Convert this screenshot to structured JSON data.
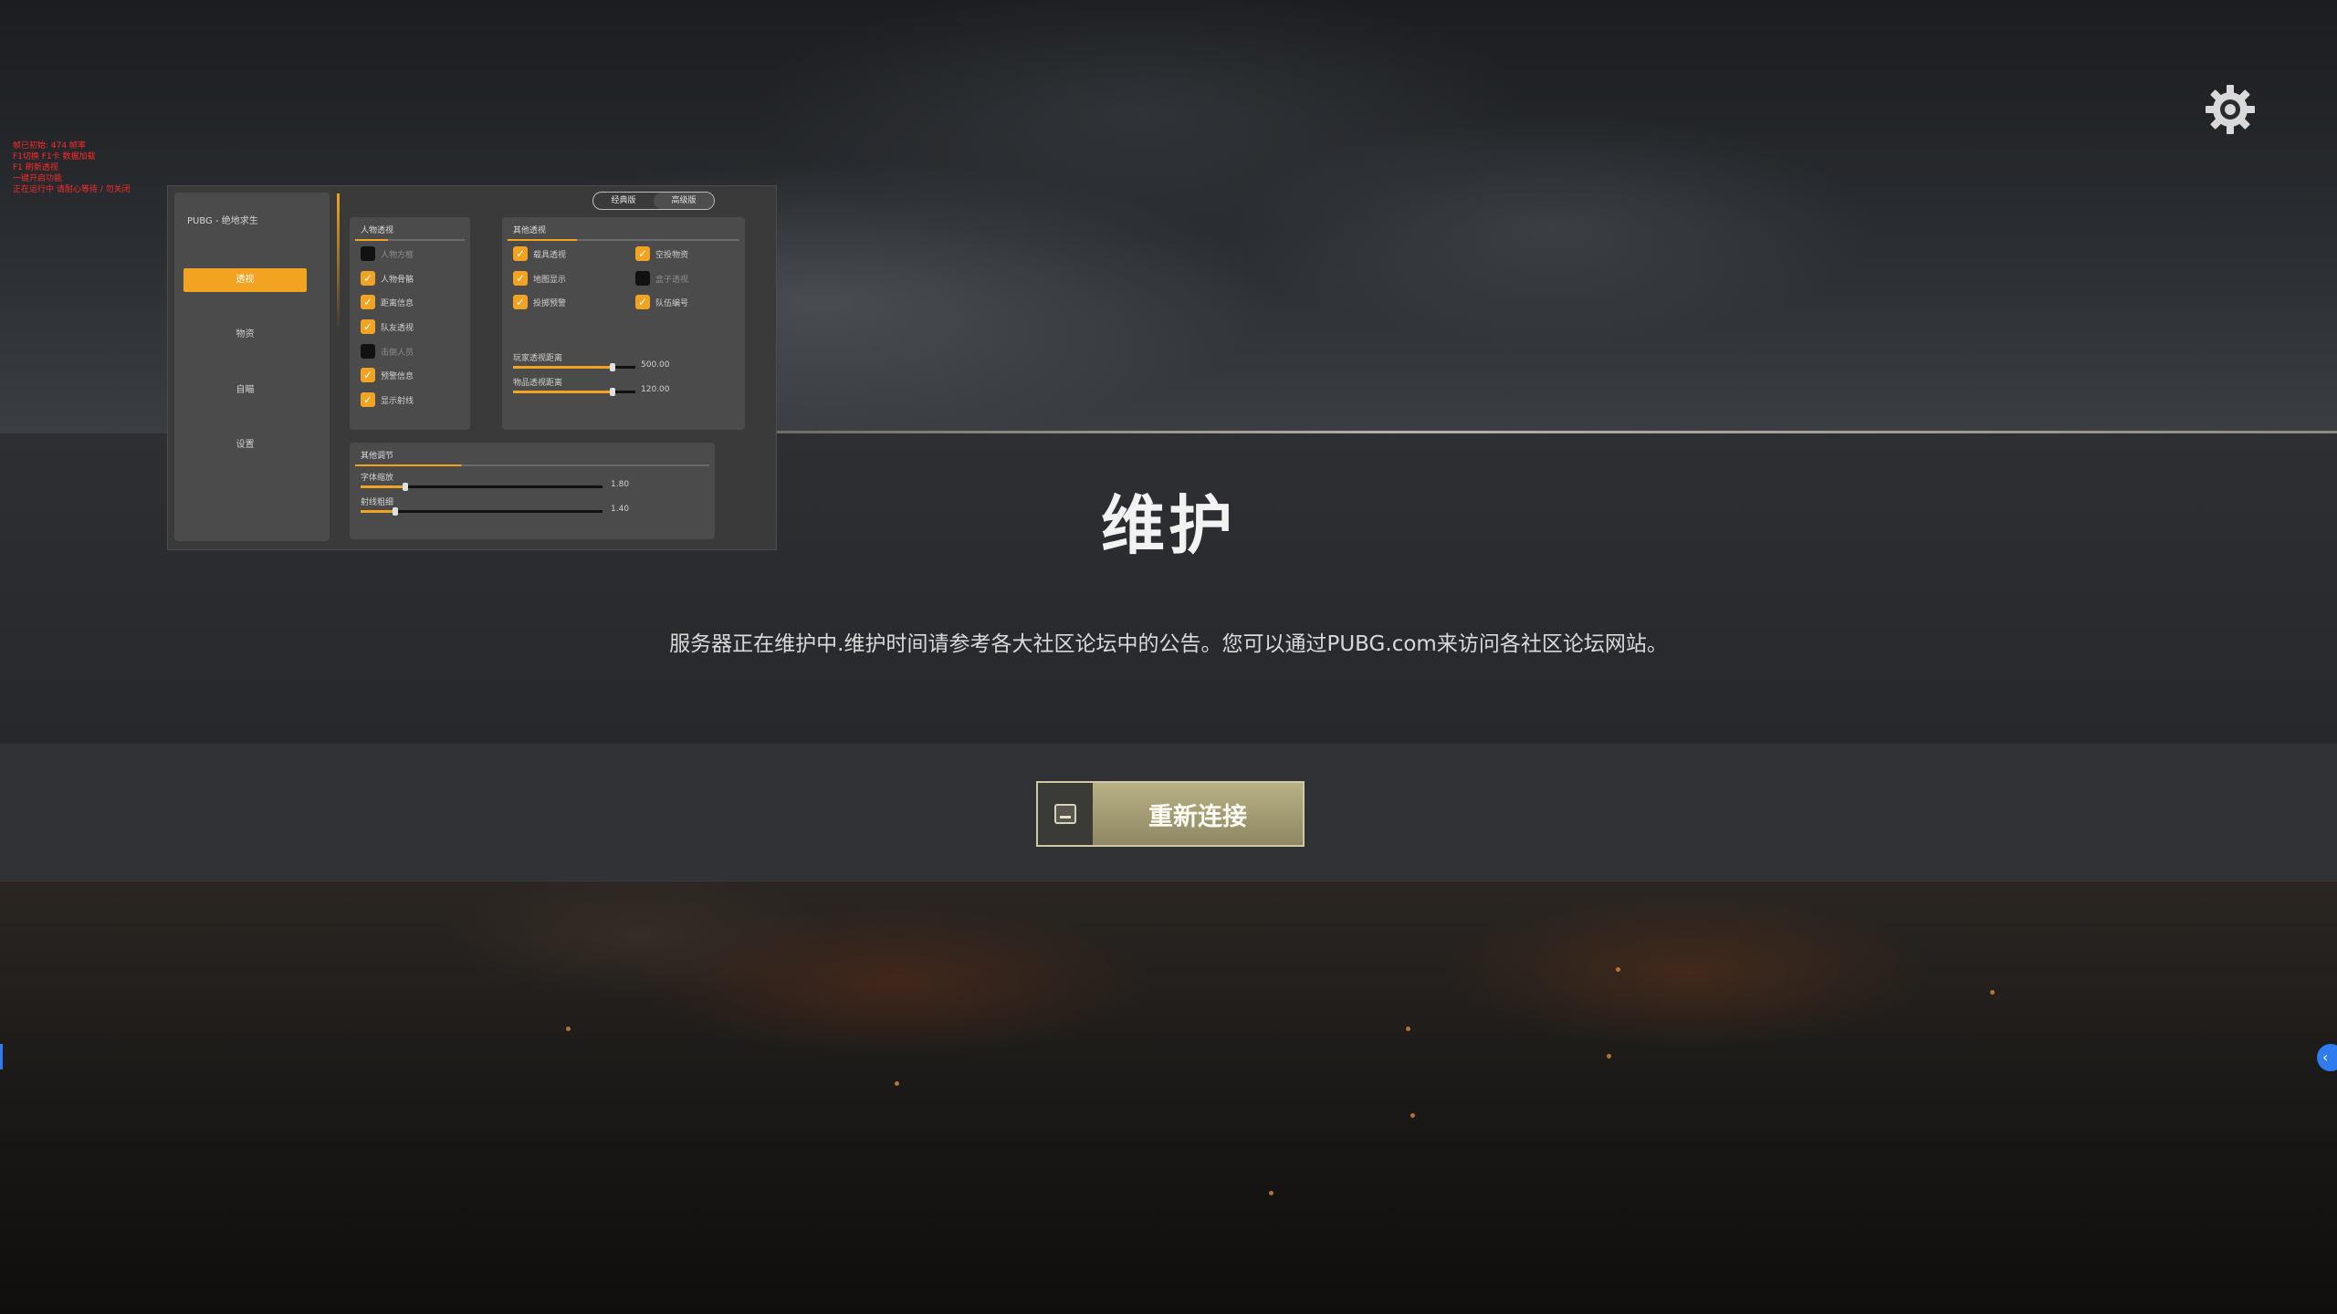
{
  "screen": {
    "title": "维护",
    "message": "服务器正在维护中.维护时间请参考各大社区论坛中的公告。您可以通过PUBG.com来访问各社区论坛网站。",
    "reconnect_label": "重新连接",
    "key_icon": "keyboard-key-icon",
    "settings_icon": "gear-icon"
  },
  "debug_overlay": {
    "lines": [
      "帧已初始: 474 帧率",
      "F1切换 F1卡 数据加载",
      "F1 刷新透视",
      "一键开启功能",
      "正在运行中 请耐心等待 / 勿关闭"
    ]
  },
  "cheat_menu": {
    "app_title": "PUBG - 绝地求生",
    "nav": [
      {
        "label": "透视",
        "active": true
      },
      {
        "label": "物资",
        "active": false
      },
      {
        "label": "自瞄",
        "active": false
      },
      {
        "label": "设置",
        "active": false
      }
    ],
    "mode_tabs": [
      {
        "label": "经典版",
        "active": false
      },
      {
        "label": "高级版",
        "active": true
      }
    ],
    "person_group": {
      "title": "人物透视",
      "items": [
        {
          "label": "人物方框",
          "checked": false
        },
        {
          "label": "人物骨骼",
          "checked": true
        },
        {
          "label": "距离信息",
          "checked": true
        },
        {
          "label": "队友透视",
          "checked": true
        },
        {
          "label": "击倒人员",
          "checked": false
        },
        {
          "label": "预警信息",
          "checked": true
        },
        {
          "label": "显示射线",
          "checked": true
        }
      ]
    },
    "other_group": {
      "title": "其他透视",
      "left_items": [
        {
          "label": "载具透视",
          "checked": true
        },
        {
          "label": "地图显示",
          "checked": true
        },
        {
          "label": "投掷预警",
          "checked": true
        }
      ],
      "right_items": [
        {
          "label": "空投物资",
          "checked": true
        },
        {
          "label": "盒子透视",
          "checked": false
        },
        {
          "label": "队伍编号",
          "checked": true
        }
      ],
      "sliders": [
        {
          "label": "玩家透视距离",
          "value": 0.82,
          "display": "500.00"
        },
        {
          "label": "物品透视距离",
          "value": 0.82,
          "display": "120.00"
        }
      ]
    },
    "adjust_group": {
      "title": "其他调节",
      "sliders": [
        {
          "label": "字体缩放",
          "value": 0.18,
          "display": "1.80"
        },
        {
          "label": "射线粗细",
          "value": 0.14,
          "display": "1.40"
        }
      ]
    }
  },
  "colors": {
    "accent": "#f1a321",
    "button": "#a39b72",
    "alert_text": "#ff2a2a"
  }
}
